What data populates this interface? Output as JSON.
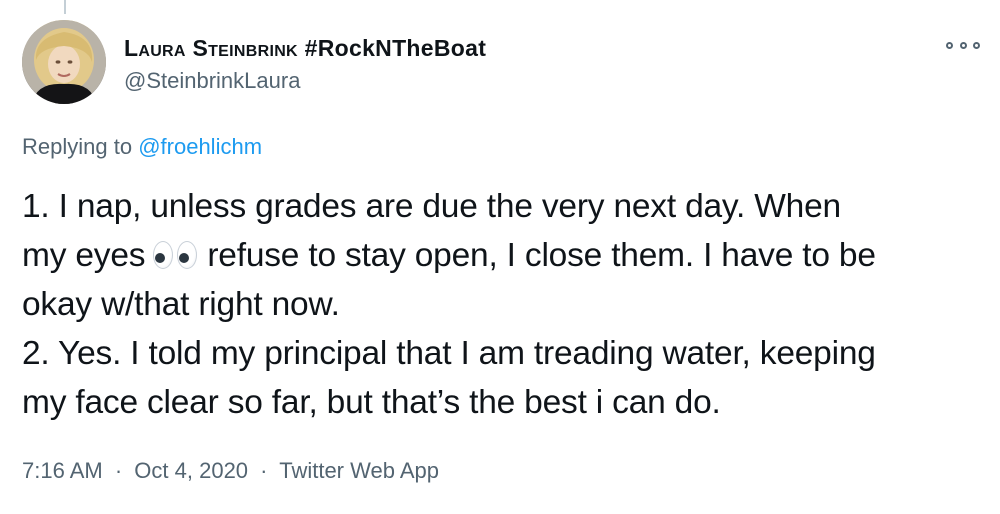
{
  "tweet": {
    "author": {
      "display_name_main": "Laura Steinbrink",
      "display_name_tag": "#RockNTheBoat",
      "handle": "@SteinbrinkLaura"
    },
    "reply_context": {
      "prefix": "Replying to",
      "mention": "@froehlichm"
    },
    "body": {
      "line1": "1. I nap, unless grades are due the very next day. When",
      "line2_before_emoji": "my eyes",
      "emoji": "eyes-emoji",
      "line2_after_emoji": "refuse to stay open, I close them. I have to be",
      "line3": "okay w/that right now.",
      "line4": "2. Yes. I told my principal that I am treading water, keeping",
      "line5": "my face clear so far, but that’s the best i can do."
    },
    "meta": {
      "time": "7:16 AM",
      "date": "Oct 4, 2020",
      "source": "Twitter Web App",
      "separator": "·"
    }
  },
  "icons": {
    "more": "more-options-icon"
  },
  "colors": {
    "text": "#0f1419",
    "secondary": "#536471",
    "link": "#1d9bf0"
  }
}
